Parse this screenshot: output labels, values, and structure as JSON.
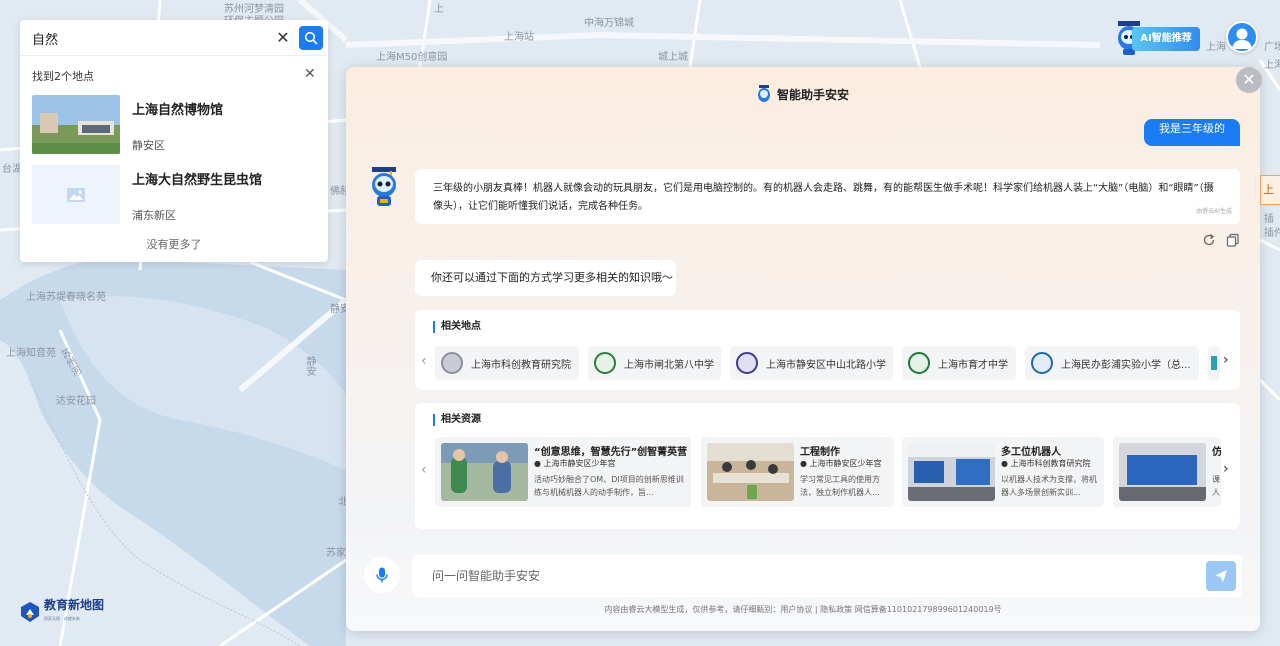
{
  "map": {
    "labels": [
      "苏州河梦清园",
      "环保主题公园",
      "中海万锦城",
      "上海站",
      "上海M50创意园",
      "城上城",
      "上海",
      "广场",
      "上海",
      "插件",
      "台湖",
      "上海苏堤春晓名苑",
      "上海知音苑",
      "苏州河",
      "达安花园",
      "静安",
      "苏家巷",
      "北",
      "静安",
      "佛赫",
      "上",
      "插"
    ]
  },
  "search": {
    "query": "自然",
    "result_count": "找到2个地点",
    "results": [
      {
        "name": "上海自然博物馆",
        "district": "静安区"
      },
      {
        "name": "上海大自然野生昆虫馆",
        "district": "浦东新区"
      }
    ],
    "no_more": "没有更多了"
  },
  "top_right": {
    "ai_button_label": "AI智能推荐"
  },
  "chat": {
    "title": "智能助手安安",
    "user_message": "我是三年级的",
    "bot_message": "三年级的小朋友真棒！机器人就像会动的玩具朋友，它们是用电脑控制的。有的机器人会走路、跳舞，有的能帮医生做手术呢！科学家们给机器人装上“大脑”（电脑）和“眼睛”（摄像头），让它们能听懂我们说话，完成各种任务。",
    "ai_generated_tag": "由睿云AI生成",
    "tip": "你还可以通过下面的方式学习更多相关的知识哦～",
    "places_title": "相关地点",
    "places": [
      {
        "name": "上海市科创教育研究院",
        "color": "#8e8ea0"
      },
      {
        "name": "上海市闸北第八中学",
        "color": "#2f7d3a"
      },
      {
        "name": "上海市静安区中山北路小学",
        "color": "#3c3c8f"
      },
      {
        "name": "上海市育才中学",
        "color": "#1f7a3a"
      },
      {
        "name": "上海民办彭浦实验小学（总...",
        "color": "#1e6aa8"
      }
    ],
    "resources_title": "相关资源",
    "resources": [
      {
        "title": "“创意思维，智慧先行”创智菁英营",
        "place": "上海市静安区少年宫",
        "desc": "活动巧妙融合了OM、DI项目的创新思维训练与机械机器人的动手制作，旨..."
      },
      {
        "title": "工程制作",
        "place": "上海市静安区少年宫",
        "desc": "学习常见工具的使用方法，独立制作机器人..."
      },
      {
        "title": "多工位机器人",
        "place": "上海市科创教育研究院",
        "desc": "以机器人技术为支撑，将机器人多场景创新实训..."
      },
      {
        "title": "仿",
        "place": "",
        "desc": "课人"
      }
    ],
    "input_placeholder": "问一问智能助手安安",
    "footer": "内容由睿云大模型生成，仅供参考，请仔细甄别：用户协议 | 隐私政策 网信算备110102179899601240019号"
  },
  "logo": {
    "name": "教育新地图",
    "sub": "探索无限 · 成就未来"
  },
  "edge_tab": "上"
}
